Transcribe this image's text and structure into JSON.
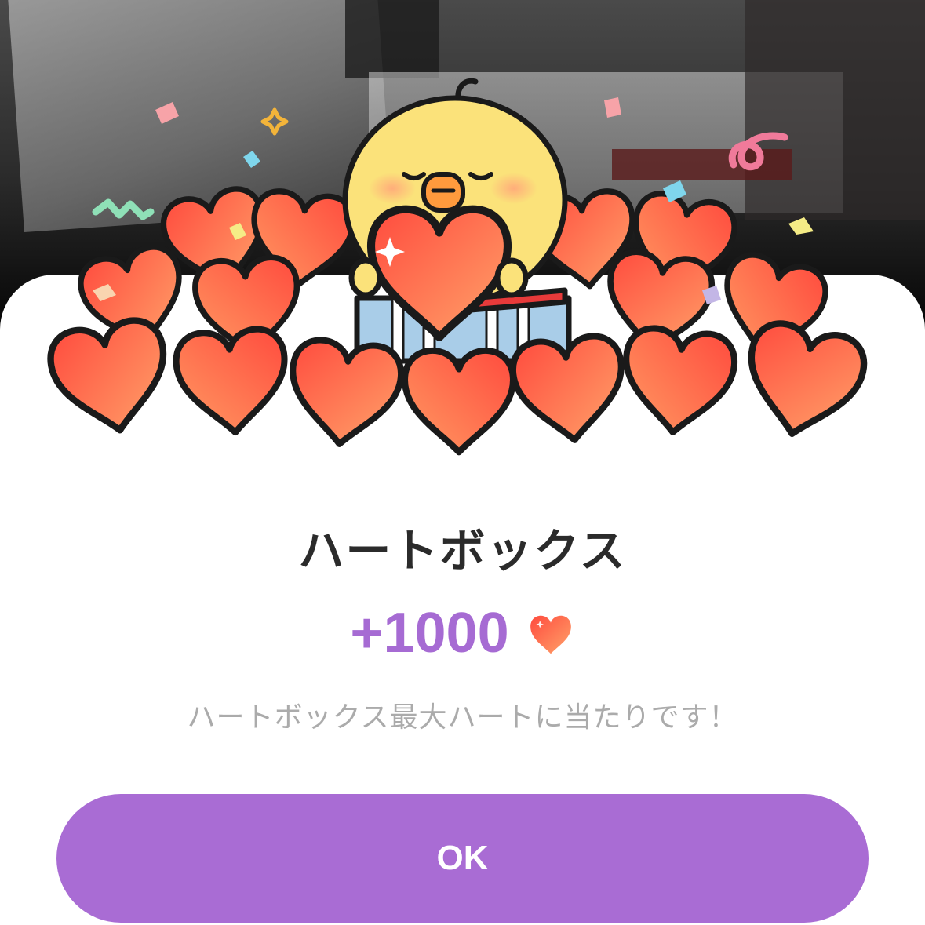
{
  "dialog": {
    "title": "ハートボックス",
    "reward_amount": "+1000",
    "reward_icon": "heart-icon",
    "message": "ハートボックス最大ハートに当たりです！",
    "ok_label": "OK"
  },
  "illustration": {
    "character": "yellow-chick-mascot",
    "items": "hearts-and-confetti"
  },
  "colors": {
    "accent": "#a96cd4",
    "reward_text": "#a66bd3",
    "title_text": "#2b2b2b",
    "message_text": "#ababab",
    "heart": "#ff5a46"
  }
}
